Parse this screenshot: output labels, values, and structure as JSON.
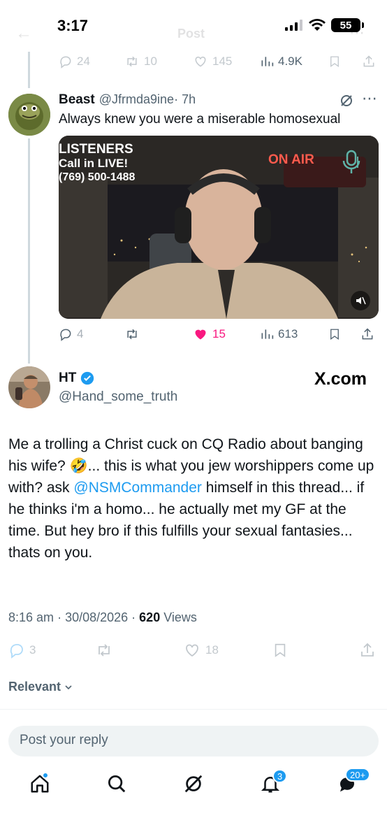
{
  "status_bar": {
    "time": "3:17",
    "battery": "55"
  },
  "faded_header": {
    "title": "Post"
  },
  "prev_tweet_actions": {
    "replies": "24",
    "reposts": "10",
    "likes": "145",
    "views": "4.9K"
  },
  "reply_tweet": {
    "name": "Beast",
    "handle": "@Jfrmda9ine",
    "time": "· 7h",
    "text": "Always knew you were a miserable homosexual",
    "media": {
      "overlay_line1": "LISTENERS",
      "overlay_line2": "Call in LIVE!",
      "overlay_line3": "(769) 500-1488",
      "on_air": "ON AIR"
    },
    "actions": {
      "replies": "4",
      "reposts": "",
      "likes": "15",
      "views": "613"
    }
  },
  "main_tweet": {
    "name": "HT",
    "handle": "@Hand_some_truth",
    "watermark": "X.com",
    "text_part1": "Me a trolling a Christ cuck on CQ Radio about banging his wife? 🤣... this is what you jew worshippers come up with? ask ",
    "mention": "@NSMCommander",
    "text_part2": "  himself in this thread... if he thinks i'm a homo... he actually met my GF at the time. But hey bro if this fulfills your sexual fantasies... thats on you.",
    "time": "8:16 am",
    "date": "30/08/2026",
    "views_count": "620",
    "views_label": "Views",
    "actions": {
      "replies": "3",
      "likes": "18"
    }
  },
  "replies_filter": {
    "label": "Relevant"
  },
  "reply_box": {
    "placeholder": "Post your reply"
  },
  "bottom_nav": {
    "notifications_badge": "3",
    "messages_badge": "20+"
  },
  "colors": {
    "accent": "#1d9bf0",
    "like_active": "#f91880",
    "muted": "#536471",
    "text": "#0f1419"
  }
}
